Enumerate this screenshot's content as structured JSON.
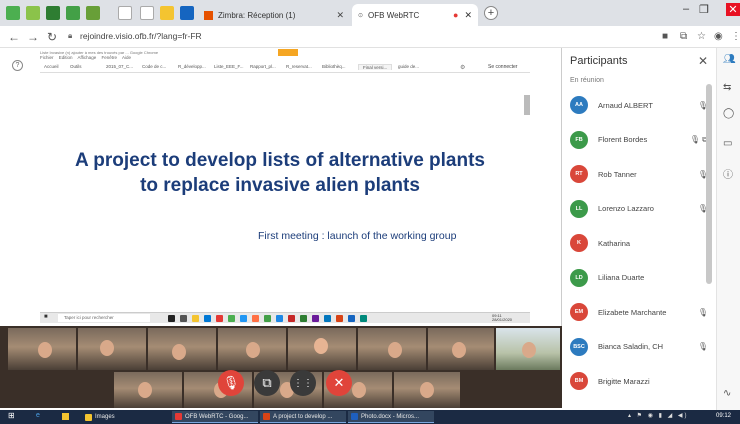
{
  "browser": {
    "tabs": [
      {
        "title": "Zimbra: Réception (1)",
        "active": false
      },
      {
        "title": "OFB WebRTC",
        "active": true
      }
    ],
    "new_tab_label": "+",
    "url": "rejoindre.visio.ofb.fr/?lang=fr-FR"
  },
  "shared_screen": {
    "window_title": "Liste Invasive (n) ajouter à mes des trouvés par ... Google Chrome",
    "menu": "Fichier  Edition  Affichage  Fenêtre  Aide",
    "tabs": [
      "Accueil",
      "Outils",
      "2015_07_C...",
      "Code de c...",
      "R_développ...",
      "Liste_EEE_F...",
      "Rapport_pl...",
      "R_reservat...",
      "Bibliothèq...",
      "Final versi...",
      "guide de..."
    ],
    "active_tab_index": 9,
    "connect_label": "Se connecter",
    "help_label": "?",
    "slide_title": "A project to develop lists of alternative plants to replace invasive alien plants",
    "slide_subtitle": "First meeting : launch of the working group",
    "taskbar_search": "Taper ici pour rechercher",
    "taskbar_time": "09:11 28/01/2020"
  },
  "participants_panel": {
    "title": "Participants",
    "section_label": "En réunion",
    "participants": [
      {
        "initials": "AA",
        "name": "Arnaud ALBERT",
        "color": "#2d7bbf",
        "mic": "🎙"
      },
      {
        "initials": "FB",
        "name": "Florent Bordes",
        "color": "#3c9a4a",
        "mic": "🎙 ⧉"
      },
      {
        "initials": "RT",
        "name": "Rob Tanner",
        "color": "#d9473a",
        "mic": "🎙"
      },
      {
        "initials": "LL",
        "name": "Lorenzo Lazzaro",
        "color": "#3c9a4a",
        "mic": "🎙"
      },
      {
        "initials": "K",
        "name": "Katharina",
        "color": "#d9473a",
        "mic": ""
      },
      {
        "initials": "LD",
        "name": "Liliana Duarte",
        "color": "#3c9a4a",
        "mic": ""
      },
      {
        "initials": "EM",
        "name": "Elizabete Marchante",
        "color": "#d9473a",
        "mic": "🎙"
      },
      {
        "initials": "BSC",
        "name": "Bianca Saladin, CH",
        "color": "#2d7bbf",
        "mic": "🎙"
      },
      {
        "initials": "BM",
        "name": "Brigitte Marazzi",
        "color": "#d9473a",
        "mic": ""
      }
    ]
  },
  "meeting_controls": {
    "mic": "🎙",
    "screen": "⧉",
    "apps": "⋮⋮",
    "hangup": "✕"
  },
  "windows_taskbar": {
    "items": [
      {
        "label": "Images"
      },
      {
        "label": "OFB WebRTC - Goog..."
      },
      {
        "label": "A project to develop ..."
      },
      {
        "label": "Photo.docx - Micros..."
      }
    ],
    "clock": "09:12"
  }
}
